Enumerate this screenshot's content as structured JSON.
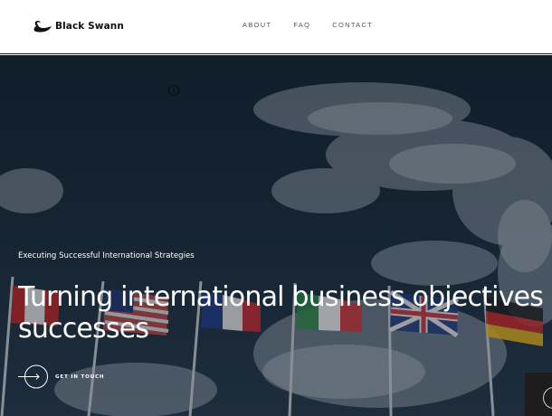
{
  "brand": {
    "name": "Black Swann",
    "logo_icon": "swan-icon"
  },
  "nav": {
    "items": [
      {
        "label": "ABOUT"
      },
      {
        "label": "FAQ"
      },
      {
        "label": "CONTACT"
      }
    ]
  },
  "hero": {
    "tagline": "Executing Successful International Strategies",
    "headline_line1": "Turning international business objectives i",
    "headline_line2": "successes",
    "cta_label": "GET IN TOUCH",
    "cta_icon": "arrow-right-circle-icon"
  },
  "colors": {
    "header_bg": "#ffffff",
    "hero_overlay": "#142331",
    "text_light": "#ffffff",
    "nav_text": "#555555"
  }
}
